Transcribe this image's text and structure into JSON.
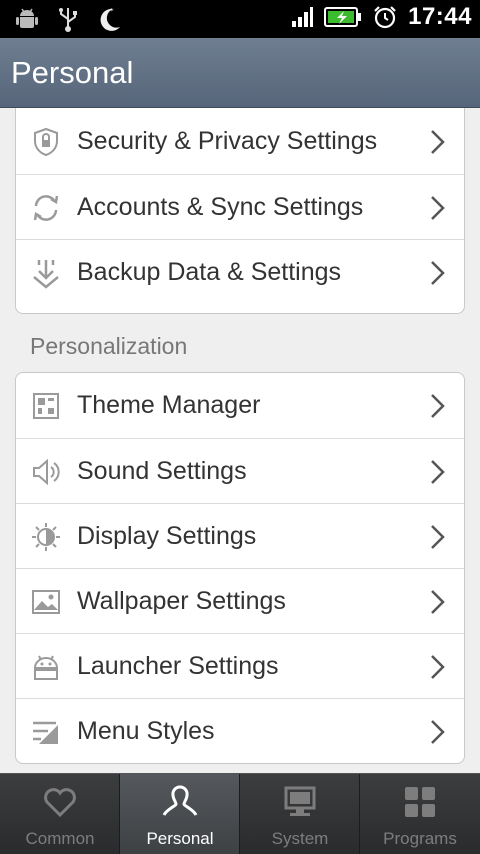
{
  "status_bar": {
    "time": "17:44",
    "left_icons": [
      "android-debug-icon",
      "usb-icon",
      "night-mode-icon"
    ],
    "right_icons": [
      "signal-icon",
      "battery-charging-icon",
      "alarm-icon"
    ]
  },
  "header": {
    "title": "Personal"
  },
  "groups": [
    {
      "heading": "",
      "items": [
        {
          "label": "Security & Privacy Settings",
          "icon": "shield-icon"
        },
        {
          "label": "Accounts & Sync Settings",
          "icon": "sync-icon"
        },
        {
          "label": "Backup Data & Settings",
          "icon": "backup-icon"
        }
      ]
    },
    {
      "heading": "Personalization",
      "items": [
        {
          "label": "Theme Manager",
          "icon": "theme-icon"
        },
        {
          "label": "Sound Settings",
          "icon": "speaker-icon"
        },
        {
          "label": "Display Settings",
          "icon": "brightness-icon"
        },
        {
          "label": "Wallpaper Settings",
          "icon": "picture-icon"
        },
        {
          "label": "Launcher Settings",
          "icon": "android-icon"
        },
        {
          "label": "Menu Styles",
          "icon": "menu-style-icon"
        }
      ]
    }
  ],
  "bottom_nav": {
    "active": "Personal",
    "tabs": [
      {
        "label": "Common",
        "icon": "heart-icon"
      },
      {
        "label": "Personal",
        "icon": "person-icon"
      },
      {
        "label": "System",
        "icon": "monitor-icon"
      },
      {
        "label": "Programs",
        "icon": "grid-icon"
      }
    ]
  },
  "colors": {
    "accent": "#5f6e82",
    "icon_gray": "#9a9a9a",
    "text": "#333333"
  }
}
